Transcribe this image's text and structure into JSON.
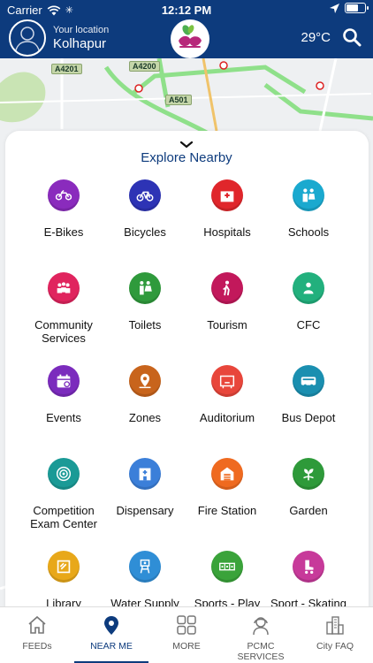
{
  "status_bar": {
    "carrier": "Carrier",
    "time": "12:12 PM"
  },
  "header": {
    "location_label": "Your location",
    "location_city": "Kolhapur",
    "temperature": "29°C"
  },
  "map": {
    "road_labels": [
      "A4201",
      "A4200",
      "A501"
    ]
  },
  "sheet": {
    "title": "Explore Nearby"
  },
  "categories": [
    {
      "label": "E-Bikes",
      "color": "#8a2bbd",
      "icon": "motorbike-icon"
    },
    {
      "label": "Bicycles",
      "color": "#2d33b5",
      "icon": "bicycle-icon"
    },
    {
      "label": "Hospitals",
      "color": "#e0262b",
      "icon": "hospital-icon"
    },
    {
      "label": "Schools",
      "color": "#1aa9cf",
      "icon": "school-icon"
    },
    {
      "label": "Community\nServices",
      "color": "#e0245e",
      "icon": "community-icon"
    },
    {
      "label": "Toilets",
      "color": "#2f9a3c",
      "icon": "toilet-icon"
    },
    {
      "label": "Tourism",
      "color": "#c2185b",
      "icon": "hiker-icon"
    },
    {
      "label": "CFC",
      "color": "#22b07d",
      "icon": "cfc-icon"
    },
    {
      "label": "Events",
      "color": "#7b2bbd",
      "icon": "calendar-icon"
    },
    {
      "label": "Zones",
      "color": "#c8641c",
      "icon": "map-pin-icon"
    },
    {
      "label": "Auditorium",
      "color": "#e8463b",
      "icon": "auditorium-icon"
    },
    {
      "label": "Bus Depot",
      "color": "#1a8fb0",
      "icon": "bus-icon"
    },
    {
      "label": "Competition\nExam Center",
      "color": "#1a9a96",
      "icon": "target-icon"
    },
    {
      "label": "Dispensary",
      "color": "#3b7fd9",
      "icon": "dispensary-icon"
    },
    {
      "label": "Fire Station",
      "color": "#ef6a20",
      "icon": "fire-station-icon"
    },
    {
      "label": "Garden",
      "color": "#2e9a3a",
      "icon": "plant-icon"
    },
    {
      "label": "Library",
      "color": "#e8a81a",
      "icon": "library-icon"
    },
    {
      "label": "Water Supply",
      "color": "#2f8ed6",
      "icon": "water-tower-icon"
    },
    {
      "label": "Sports - Play",
      "color": "#3aa33a",
      "icon": "sports-play-icon"
    },
    {
      "label": "Sport - Skating",
      "color": "#c73a9a",
      "icon": "skate-icon"
    }
  ],
  "nav": [
    {
      "label": "FEEDs",
      "icon": "home-icon",
      "active": false
    },
    {
      "label": "NEAR ME",
      "icon": "location-pin-icon",
      "active": true
    },
    {
      "label": "MORE",
      "icon": "grid-icon",
      "active": false
    },
    {
      "label": "PCMC SERVICES",
      "icon": "support-agent-icon",
      "active": false
    },
    {
      "label": "City FAQ",
      "icon": "city-icon",
      "active": false
    }
  ]
}
